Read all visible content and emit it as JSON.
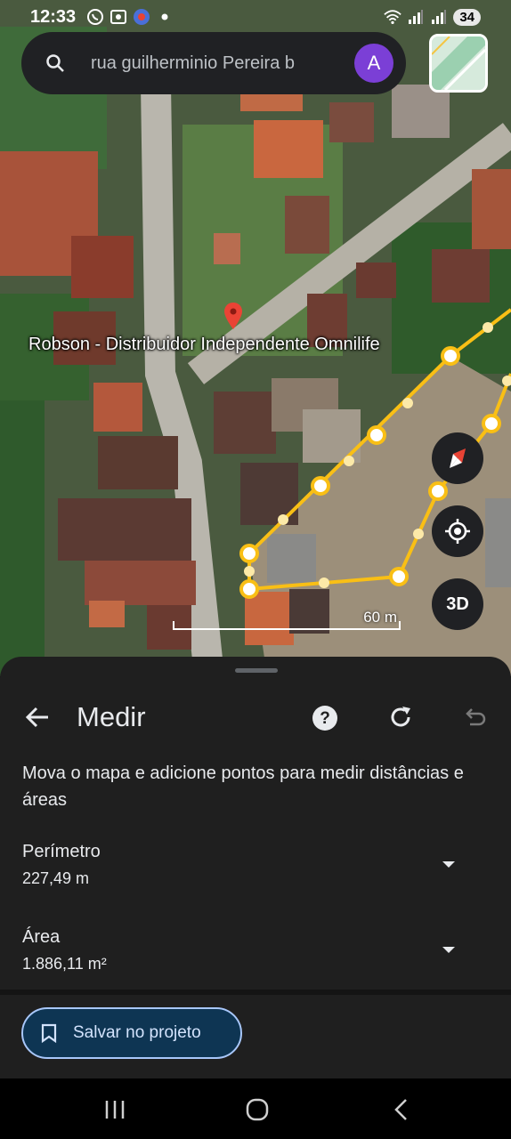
{
  "status_bar": {
    "time": "12:33",
    "battery": "34",
    "icons_left": [
      "whatsapp-icon",
      "screenshot-icon",
      "app-icon",
      "dot-icon"
    ],
    "icons_right": [
      "wifi-icon",
      "signal-icon",
      "signal-icon"
    ]
  },
  "search": {
    "query": "rua guilherminio Pereira  b",
    "avatar_letter": "A",
    "icon": "search-icon"
  },
  "map": {
    "place_label": "Robson - Distribuidor Independente Omnilife",
    "scale_label": "60 m",
    "three_d_label": "3D",
    "measure_line_color": "#f9bf15",
    "pin_color": "#ea4335",
    "controls": [
      "compass-icon",
      "my-location-icon",
      "3d-button"
    ]
  },
  "sheet": {
    "title": "Medir",
    "instruction": "Mova o mapa e adicione pontos para medir distâncias e áreas",
    "perimeter_label": "Perímetro",
    "perimeter_value": "227,49 m",
    "area_label": "Área",
    "area_value": "1.886,11 m²",
    "save_label": "Salvar no projeto",
    "accent": "#a8c7fa"
  },
  "nav_bar": {
    "items": [
      "recent-apps-icon",
      "home-icon",
      "back-icon"
    ]
  }
}
